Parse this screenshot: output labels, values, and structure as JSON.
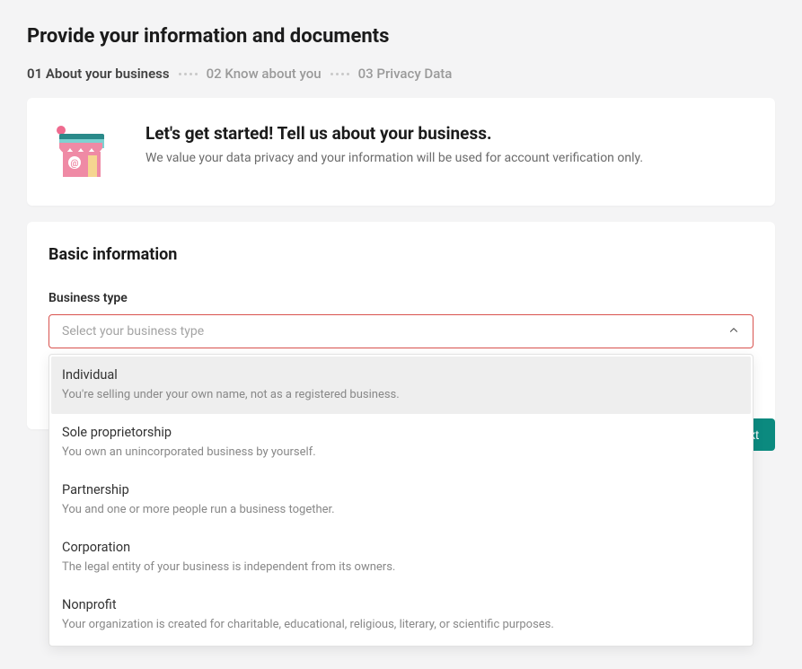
{
  "page": {
    "title": "Provide your information and documents"
  },
  "steps": [
    {
      "label": "01 About your business",
      "active": true
    },
    {
      "label": "02 Know about you",
      "active": false
    },
    {
      "label": "03 Privacy Data",
      "active": false
    }
  ],
  "intro": {
    "heading": "Let's get started! Tell us about your business.",
    "subtext": "We value your data privacy and your information will be used for account verification only."
  },
  "form": {
    "section_title": "Basic information",
    "business_type": {
      "label": "Business type",
      "placeholder": "Select your business type",
      "options": [
        {
          "title": "Individual",
          "desc": "You're selling under your own name, not as a registered business."
        },
        {
          "title": "Sole proprietorship",
          "desc": "You own an unincorporated business by yourself."
        },
        {
          "title": "Partnership",
          "desc": "You and one or more people run a business together."
        },
        {
          "title": "Corporation",
          "desc": "The legal entity of your business is independent from its owners."
        },
        {
          "title": "Nonprofit",
          "desc": "Your organization is created for charitable, educational, religious, literary, or scientific purposes."
        }
      ]
    }
  },
  "buttons": {
    "next": "Next"
  },
  "colors": {
    "accent": "#0b8a7f",
    "error_border": "#d9534f"
  }
}
